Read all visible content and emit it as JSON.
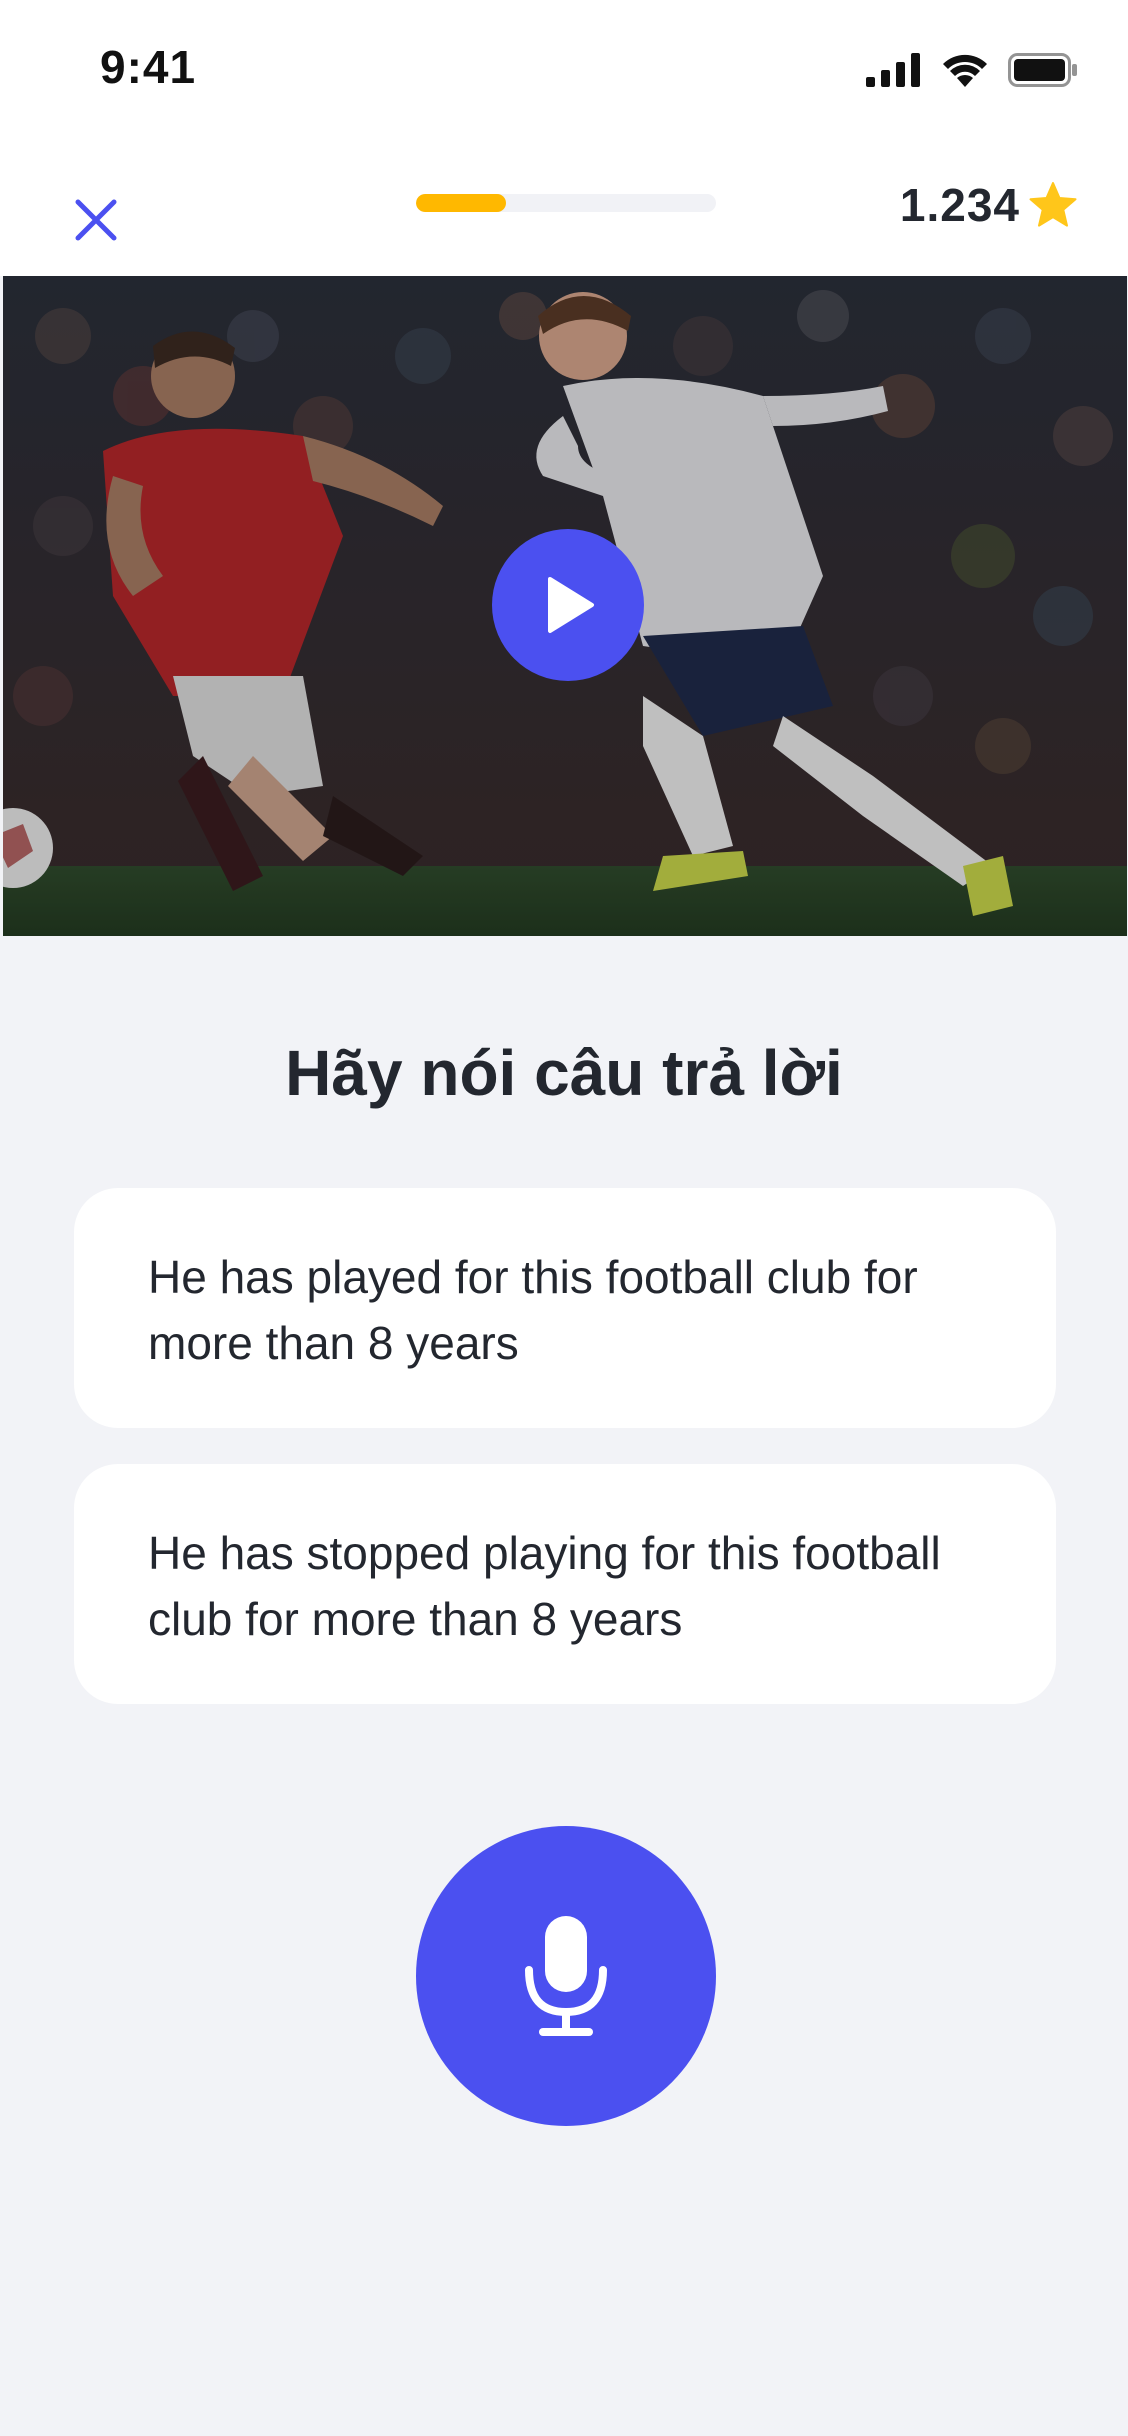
{
  "status_bar": {
    "time": "9:41",
    "icons": [
      "signal-icon",
      "wifi-icon",
      "battery-icon"
    ]
  },
  "top_bar": {
    "close_icon": "close-icon",
    "progress_fraction": 0.3,
    "score": "1.234",
    "score_icon": "star-icon"
  },
  "media": {
    "play_icon": "play-icon"
  },
  "question": {
    "prompt": "Hãy nói câu trả lời",
    "answers": [
      "He has played for this football club for more than 8 years",
      "He has stopped playing for this football club for more than 8 years"
    ]
  },
  "mic": {
    "icon": "microphone-icon"
  },
  "colors": {
    "accent": "#4b50f0",
    "progress": "#ffb800",
    "star": "#ffc61a",
    "background": "#f2f3f7",
    "text": "#23272f"
  }
}
